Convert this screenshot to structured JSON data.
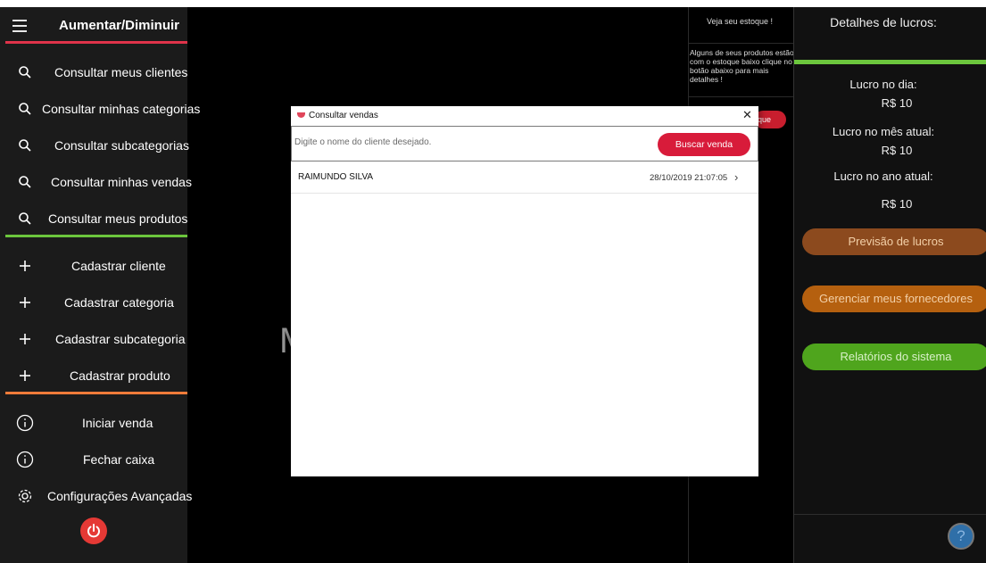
{
  "sidebar": {
    "title": "Aumentar/Diminuir",
    "search_items": [
      {
        "label": "Consultar meus clientes",
        "icon": "search-icon"
      },
      {
        "label": "Consultar minhas categorias",
        "icon": "search-icon"
      },
      {
        "label": "Consultar subcategorias",
        "icon": "search-icon"
      },
      {
        "label": "Consultar minhas vendas",
        "icon": "search-icon"
      },
      {
        "label": "Consultar meus produtos",
        "icon": "search-icon"
      }
    ],
    "add_items": [
      {
        "label": "Cadastrar cliente",
        "icon": "plus-icon"
      },
      {
        "label": "Cadastrar categoria",
        "icon": "plus-icon"
      },
      {
        "label": "Cadastrar subcategoria",
        "icon": "plus-icon"
      },
      {
        "label": "Cadastrar produto",
        "icon": "plus-icon"
      }
    ],
    "other_items": [
      {
        "label": "Iniciar venda",
        "icon": "info-icon"
      },
      {
        "label": "Fechar caixa",
        "icon": "info-icon"
      },
      {
        "label": "Configurações Avançadas",
        "icon": "gear-icon"
      }
    ],
    "colors": {
      "title_divider": "#e0334a",
      "search_divider": "#6cc63d",
      "add_divider": "#f07c3a",
      "power": "#e53935"
    }
  },
  "center": {
    "partial_text": "M"
  },
  "stock": {
    "title": "Veja seu estoque !",
    "message": "Alguns de seus produtos estão com o estoque baixo clique no botão abaixo para mais detalhes !",
    "button_partial": "que"
  },
  "profits": {
    "title": "Detalhes de lucros:",
    "day_label": "Lucro no dia:",
    "day_value": "R$ 10",
    "month_label": "Lucro no mês atual:",
    "month_value": "R$ 10",
    "year_label": "Lucro no ano atual:",
    "year_value": "R$ 10",
    "buttons": [
      {
        "label": "Previsão de lucros",
        "color": "#8c4a1e"
      },
      {
        "label": "Gerenciar meus fornecedores",
        "color": "#b5600f"
      },
      {
        "label": "Relatórios do sistema",
        "color": "#4fa51d"
      }
    ],
    "help": "?"
  },
  "dialog": {
    "title": "Consultar vendas",
    "close": "✕",
    "search_placeholder": "Digite o nome do cliente desejado.",
    "search_button": "Buscar venda",
    "results": [
      {
        "name": "RAIMUNDO SILVA",
        "date": "28/10/2019 21:07:05"
      }
    ]
  }
}
